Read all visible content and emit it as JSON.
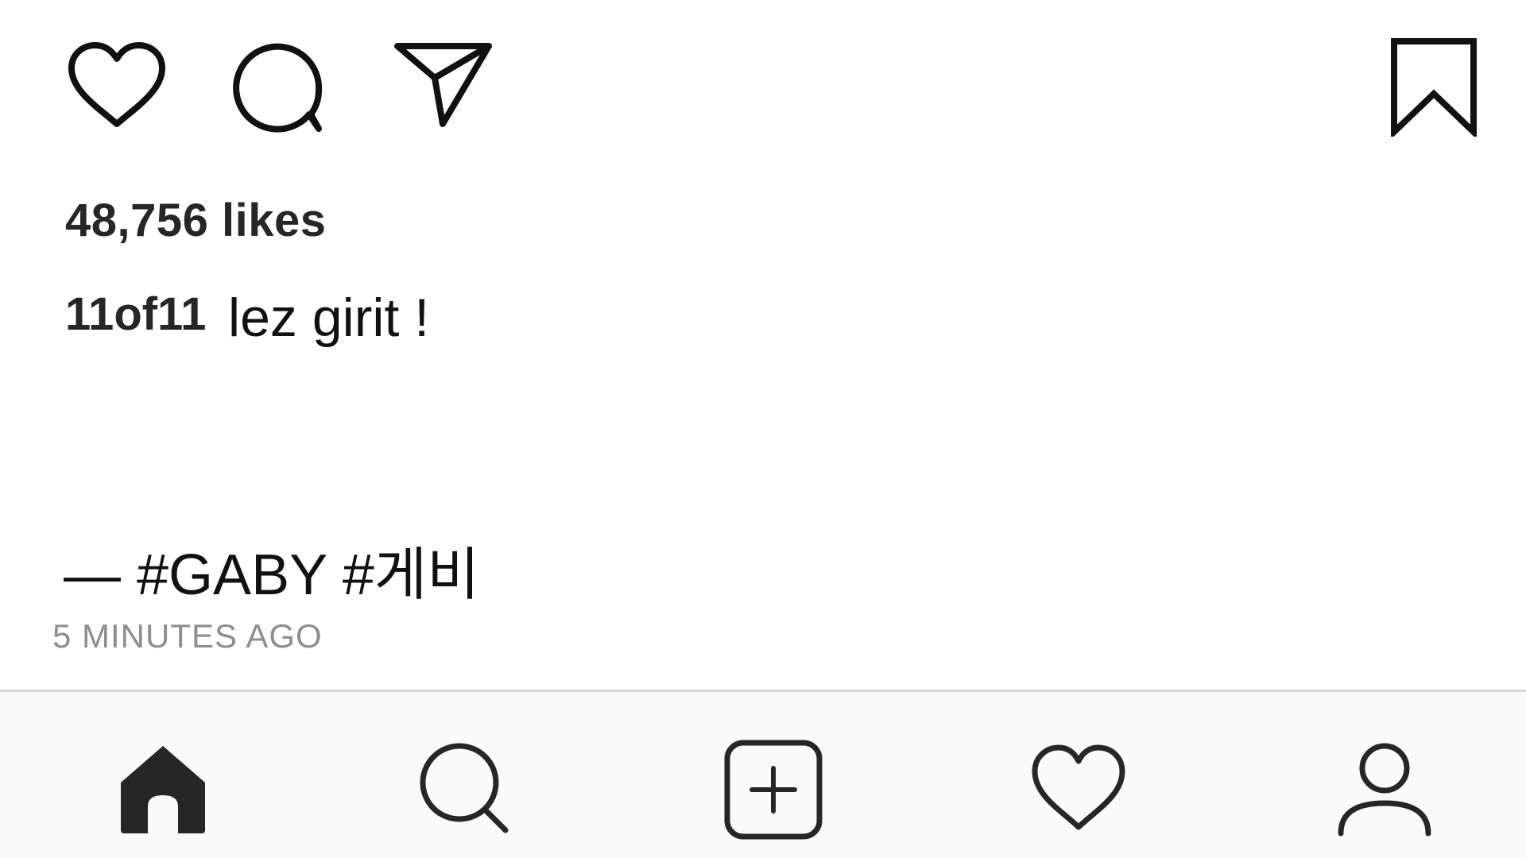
{
  "post": {
    "likes_text": "48,756 likes",
    "caption": {
      "username": "11of11",
      "text": "lez girit !",
      "tags_line": "— #GABY #게비"
    },
    "timestamp": "5 MINUTES AGO"
  },
  "actions": {
    "like_icon": "heart-outline-icon",
    "comment_icon": "comment-bubble-icon",
    "share_icon": "paper-plane-icon",
    "save_icon": "bookmark-outline-icon"
  },
  "tab_bar": {
    "items": [
      {
        "id": "home",
        "icon": "home-filled-icon",
        "active": true
      },
      {
        "id": "search",
        "icon": "search-icon",
        "active": false
      },
      {
        "id": "new-post",
        "icon": "plus-square-icon",
        "active": false
      },
      {
        "id": "activity",
        "icon": "heart-outline-icon",
        "active": false
      },
      {
        "id": "profile",
        "icon": "user-outline-icon",
        "active": false
      }
    ]
  },
  "colors": {
    "background": "#ffffff",
    "text_primary": "#262626",
    "text_secondary": "#8e8e8e",
    "tab_bar_bg": "#fafafa",
    "divider": "#d8d8d8"
  }
}
